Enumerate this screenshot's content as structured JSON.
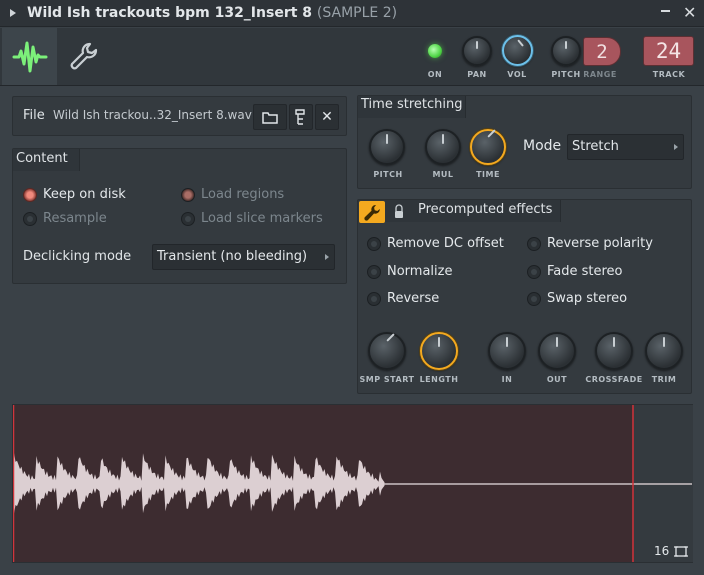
{
  "window": {
    "title": "Wild Ish trackouts bpm 132_Insert 8",
    "subtitle": "(SAMPLE 2)",
    "close_glyph": "✕"
  },
  "toolbar": {
    "on_label": "ON",
    "pan_label": "PAN",
    "vol_label": "VOL",
    "pitch_label": "PITCH",
    "range_label": "RANGE",
    "range_value": "2",
    "track_label": "TRACK",
    "track_value": "24",
    "icons": [
      "waveform-icon",
      "wrench-icon"
    ]
  },
  "file": {
    "label": "File",
    "name": "Wild Ish trackou..32_Insert 8.wav",
    "close_glyph": "✕"
  },
  "content": {
    "header": "Content",
    "keep_on_disk": "Keep on disk",
    "resample": "Resample",
    "load_regions": "Load regions",
    "load_slice_markers": "Load slice markers",
    "declicking_label": "Declicking mode",
    "declicking_value": "Transient (no bleeding)"
  },
  "time_stretching": {
    "header": "Time stretching",
    "pitch_label": "PITCH",
    "mul_label": "MUL",
    "time_label": "TIME",
    "mode_label": "Mode",
    "mode_value": "Stretch"
  },
  "precomputed": {
    "header": "Precomputed effects",
    "effects_left": [
      "Remove DC offset",
      "Normalize",
      "Reverse"
    ],
    "effects_right": [
      "Reverse polarity",
      "Fade stereo",
      "Swap stereo"
    ],
    "knobs": {
      "smp_start": "SMP START",
      "length": "LENGTH",
      "in": "IN",
      "out": "OUT",
      "crossfade": "CROSSFADE",
      "trim": "TRIM"
    }
  },
  "waveform": {
    "zoom_value": "16"
  },
  "colors": {
    "accent_orange": "#f4a91f",
    "accent_blue": "#6cc0ea",
    "led_green": "#4ed545",
    "display_red": "#a8555d",
    "waveform_bg": "#3d2c30",
    "marker_red": "#d0353c"
  }
}
